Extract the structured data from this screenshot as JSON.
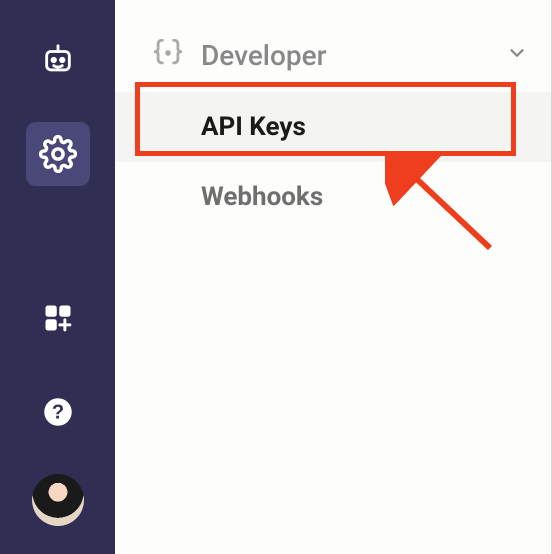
{
  "sidebar": {
    "items": [
      {
        "name": "bot-icon",
        "active": false
      },
      {
        "name": "settings-icon",
        "active": true
      },
      {
        "name": "apps-icon",
        "active": false
      },
      {
        "name": "help-icon",
        "active": false
      }
    ]
  },
  "main": {
    "section_label": "Developer",
    "menu": [
      {
        "label": "API Keys",
        "selected": true
      },
      {
        "label": "Webhooks",
        "selected": false
      }
    ]
  },
  "annotation": {
    "highlight_color": "#ef3e1e"
  }
}
